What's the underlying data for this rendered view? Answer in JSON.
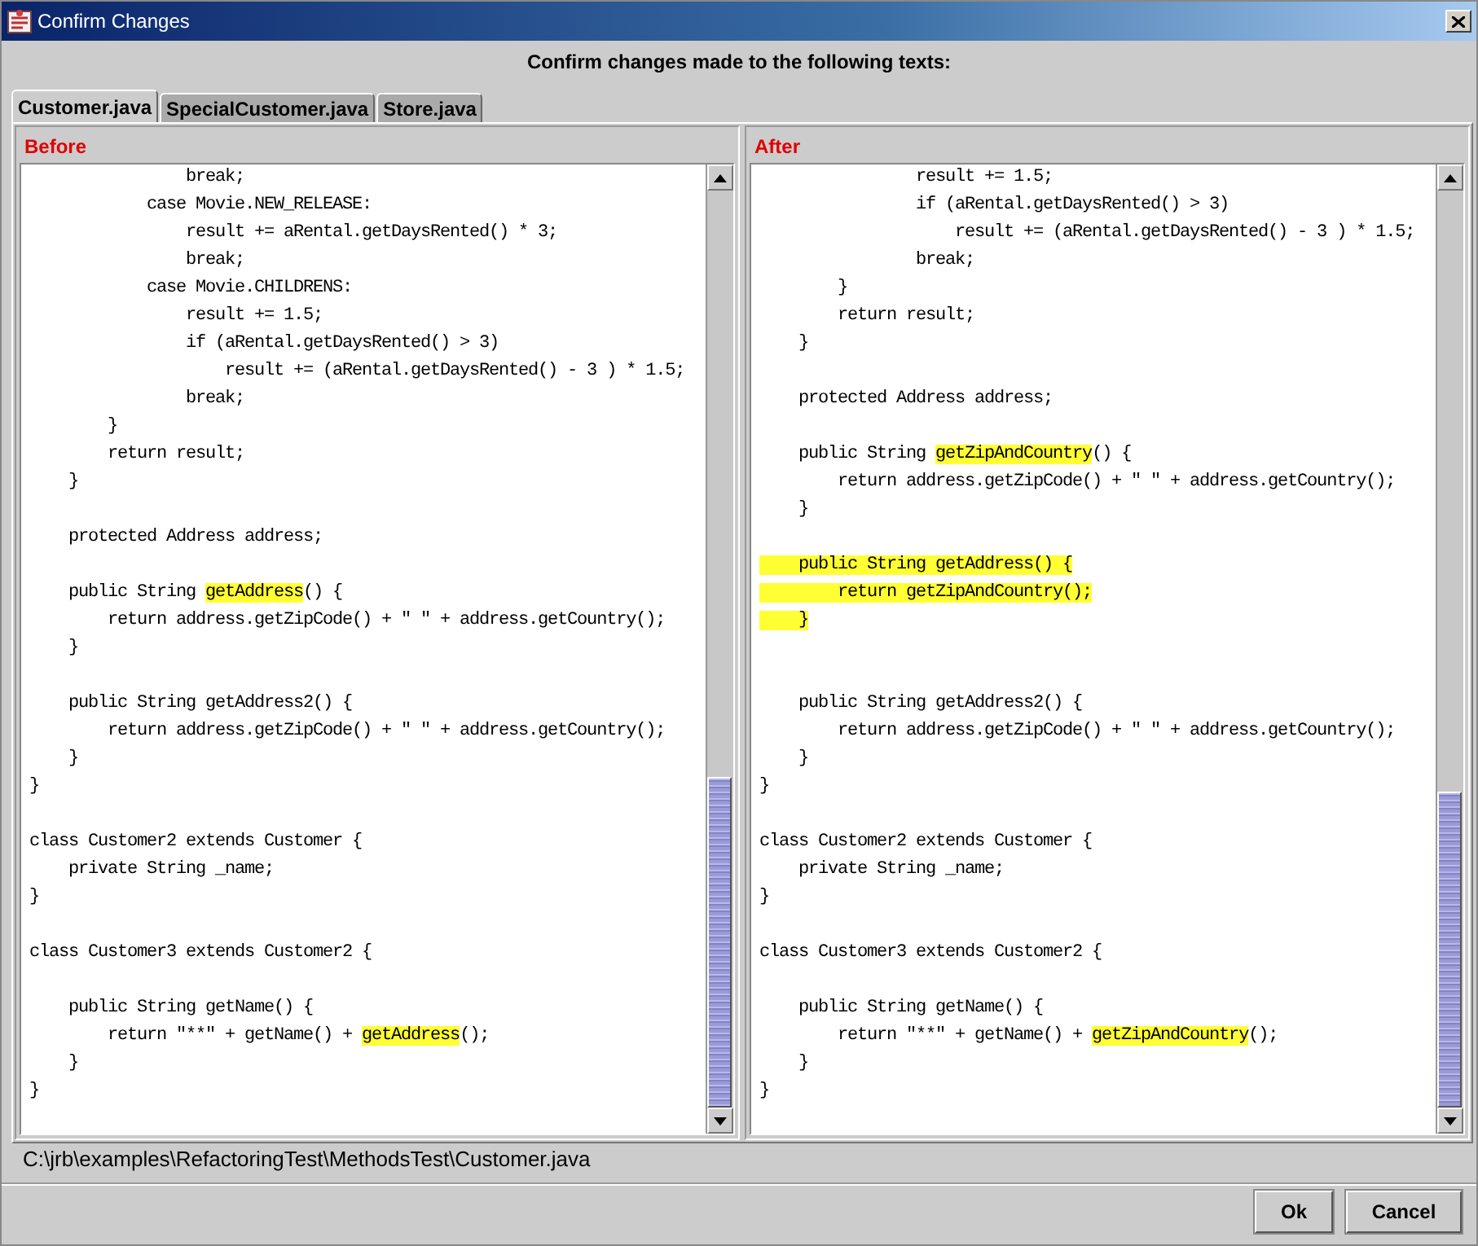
{
  "window": {
    "title": "Confirm Changes"
  },
  "heading": "Confirm changes made to the following texts:",
  "tabs": [
    {
      "label": "Customer.java",
      "selected": true
    },
    {
      "label": "SpecialCustomer.java",
      "selected": false
    },
    {
      "label": "Store.java",
      "selected": false
    }
  ],
  "panes": [
    {
      "label": "Before",
      "lines": [
        {
          "kind": "code",
          "parts": [
            {
              "text": "                break;",
              "highlighted": false
            }
          ]
        },
        {
          "kind": "code",
          "parts": [
            {
              "text": "            case Movie.NEW_RELEASE:",
              "highlighted": false
            }
          ]
        },
        {
          "kind": "code",
          "parts": [
            {
              "text": "                result += aRental.getDaysRented() * 3;",
              "highlighted": false
            }
          ]
        },
        {
          "kind": "code",
          "parts": [
            {
              "text": "                break;",
              "highlighted": false
            }
          ]
        },
        {
          "kind": "code",
          "parts": [
            {
              "text": "            case Movie.CHILDRENS:",
              "highlighted": false
            }
          ]
        },
        {
          "kind": "code",
          "parts": [
            {
              "text": "                result += 1.5;",
              "highlighted": false
            }
          ]
        },
        {
          "kind": "code",
          "parts": [
            {
              "text": "                if (aRental.getDaysRented() > 3)",
              "highlighted": false
            }
          ]
        },
        {
          "kind": "code",
          "parts": [
            {
              "text": "                    result += (aRental.getDaysRented() - 3 ) * 1.5;",
              "highlighted": false
            }
          ]
        },
        {
          "kind": "code",
          "parts": [
            {
              "text": "                break;",
              "highlighted": false
            }
          ]
        },
        {
          "kind": "code",
          "parts": [
            {
              "text": "        }",
              "highlighted": false
            }
          ]
        },
        {
          "kind": "code",
          "parts": [
            {
              "text": "        return result;",
              "highlighted": false
            }
          ]
        },
        {
          "kind": "code",
          "parts": [
            {
              "text": "    }",
              "highlighted": false
            }
          ]
        },
        {
          "kind": "blank"
        },
        {
          "kind": "code",
          "parts": [
            {
              "text": "    protected Address address;",
              "highlighted": false
            }
          ]
        },
        {
          "kind": "blank"
        },
        {
          "kind": "code",
          "parts": [
            {
              "text": "    public String ",
              "highlighted": false
            },
            {
              "text": "getAddress",
              "highlighted": true
            },
            {
              "text": "() {",
              "highlighted": false
            }
          ]
        },
        {
          "kind": "code",
          "parts": [
            {
              "text": "        return address.getZipCode() + \" \" + address.getCountry();",
              "highlighted": false
            }
          ]
        },
        {
          "kind": "code",
          "parts": [
            {
              "text": "    }",
              "highlighted": false
            }
          ]
        },
        {
          "kind": "blank"
        },
        {
          "kind": "code",
          "parts": [
            {
              "text": "    public String getAddress2() {",
              "highlighted": false
            }
          ]
        },
        {
          "kind": "code",
          "parts": [
            {
              "text": "        return address.getZipCode() + \" \" + address.getCountry();",
              "highlighted": false
            }
          ]
        },
        {
          "kind": "code",
          "parts": [
            {
              "text": "    }",
              "highlighted": false
            }
          ]
        },
        {
          "kind": "code",
          "parts": [
            {
              "text": "}",
              "highlighted": false
            }
          ]
        },
        {
          "kind": "blank"
        },
        {
          "kind": "code",
          "parts": [
            {
              "text": "class Customer2 extends Customer {",
              "highlighted": false
            }
          ]
        },
        {
          "kind": "code",
          "parts": [
            {
              "text": "    private String _name;",
              "highlighted": false
            }
          ]
        },
        {
          "kind": "code",
          "parts": [
            {
              "text": "}",
              "highlighted": false
            }
          ]
        },
        {
          "kind": "blank"
        },
        {
          "kind": "code",
          "parts": [
            {
              "text": "class Customer3 extends Customer2 {",
              "highlighted": false
            }
          ]
        },
        {
          "kind": "blank"
        },
        {
          "kind": "code",
          "parts": [
            {
              "text": "    public String getName() {",
              "highlighted": false
            }
          ]
        },
        {
          "kind": "code",
          "parts": [
            {
              "text": "        return \"**\" + getName() + ",
              "highlighted": false
            },
            {
              "text": "getAddress",
              "highlighted": true
            },
            {
              "text": "();",
              "highlighted": false
            }
          ]
        },
        {
          "kind": "code",
          "parts": [
            {
              "text": "    }",
              "highlighted": false
            }
          ]
        },
        {
          "kind": "code",
          "parts": [
            {
              "text": "}",
              "highlighted": false
            }
          ]
        }
      ]
    },
    {
      "label": "After",
      "lines": [
        {
          "kind": "code",
          "parts": [
            {
              "text": "                result += 1.5;",
              "highlighted": false
            }
          ]
        },
        {
          "kind": "code",
          "parts": [
            {
              "text": "                if (aRental.getDaysRented() > 3)",
              "highlighted": false
            }
          ]
        },
        {
          "kind": "code",
          "parts": [
            {
              "text": "                    result += (aRental.getDaysRented() - 3 ) * 1.5;",
              "highlighted": false
            }
          ]
        },
        {
          "kind": "code",
          "parts": [
            {
              "text": "                break;",
              "highlighted": false
            }
          ]
        },
        {
          "kind": "code",
          "parts": [
            {
              "text": "        }",
              "highlighted": false
            }
          ]
        },
        {
          "kind": "code",
          "parts": [
            {
              "text": "        return result;",
              "highlighted": false
            }
          ]
        },
        {
          "kind": "code",
          "parts": [
            {
              "text": "    }",
              "highlighted": false
            }
          ]
        },
        {
          "kind": "blank"
        },
        {
          "kind": "code",
          "parts": [
            {
              "text": "    protected Address address;",
              "highlighted": false
            }
          ]
        },
        {
          "kind": "blank"
        },
        {
          "kind": "code",
          "parts": [
            {
              "text": "    public String ",
              "highlighted": false
            },
            {
              "text": "getZipAndCountry",
              "highlighted": true
            },
            {
              "text": "() {",
              "highlighted": false
            }
          ]
        },
        {
          "kind": "code",
          "parts": [
            {
              "text": "        return address.getZipCode() + \" \" + address.getCountry();",
              "highlighted": false
            }
          ]
        },
        {
          "kind": "code",
          "parts": [
            {
              "text": "    }",
              "highlighted": false
            }
          ]
        },
        {
          "kind": "blank"
        },
        {
          "kind": "code",
          "parts": [
            {
              "text": "    public String getAddress() {",
              "highlighted": true
            }
          ]
        },
        {
          "kind": "code",
          "parts": [
            {
              "text": "        return getZipAndCountry();",
              "highlighted": true
            }
          ]
        },
        {
          "kind": "code",
          "parts": [
            {
              "text": "    }",
              "highlighted": true
            }
          ]
        },
        {
          "kind": "blank"
        },
        {
          "kind": "blank"
        },
        {
          "kind": "code",
          "parts": [
            {
              "text": "    public String getAddress2() {",
              "highlighted": false
            }
          ]
        },
        {
          "kind": "code",
          "parts": [
            {
              "text": "        return address.getZipCode() + \" \" + address.getCountry();",
              "highlighted": false
            }
          ]
        },
        {
          "kind": "code",
          "parts": [
            {
              "text": "    }",
              "highlighted": false
            }
          ]
        },
        {
          "kind": "code",
          "parts": [
            {
              "text": "}",
              "highlighted": false
            }
          ]
        },
        {
          "kind": "blank"
        },
        {
          "kind": "code",
          "parts": [
            {
              "text": "class Customer2 extends Customer {",
              "highlighted": false
            }
          ]
        },
        {
          "kind": "code",
          "parts": [
            {
              "text": "    private String _name;",
              "highlighted": false
            }
          ]
        },
        {
          "kind": "code",
          "parts": [
            {
              "text": "}",
              "highlighted": false
            }
          ]
        },
        {
          "kind": "blank"
        },
        {
          "kind": "code",
          "parts": [
            {
              "text": "class Customer3 extends Customer2 {",
              "highlighted": false
            }
          ]
        },
        {
          "kind": "blank"
        },
        {
          "kind": "code",
          "parts": [
            {
              "text": "    public String getName() {",
              "highlighted": false
            }
          ]
        },
        {
          "kind": "code",
          "parts": [
            {
              "text": "        return \"**\" + getName() + ",
              "highlighted": false
            },
            {
              "text": "getZipAndCountry",
              "highlighted": true
            },
            {
              "text": "();",
              "highlighted": false
            }
          ]
        },
        {
          "kind": "code",
          "parts": [
            {
              "text": "    }",
              "highlighted": false
            }
          ]
        },
        {
          "kind": "code",
          "parts": [
            {
              "text": "}",
              "highlighted": false
            }
          ]
        }
      ]
    }
  ],
  "file_path": "C:\\jrb\\examples\\RefactoringTest\\MethodsTest\\Customer.java",
  "buttons": [
    "Ok",
    "Cancel"
  ]
}
